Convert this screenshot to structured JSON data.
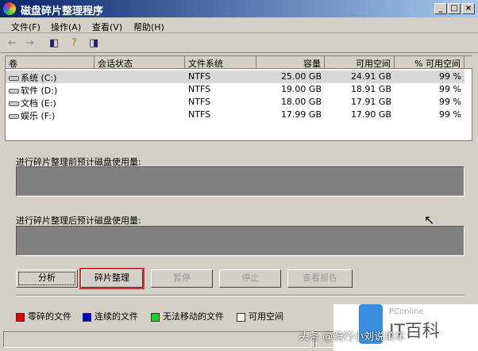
{
  "window": {
    "title": "磁盘碎片整理程序",
    "min": "_",
    "max": "□",
    "close": "×"
  },
  "menu": [
    "文件(F)",
    "操作(A)",
    "查看(V)",
    "帮助(H)"
  ],
  "columns": [
    "卷",
    "会话状态",
    "文件系统",
    "容量",
    "可用空间",
    "% 可用空间"
  ],
  "volumes": [
    {
      "name": "系统 (C:)",
      "status": "",
      "fs": "NTFS",
      "capacity": "25.00 GB",
      "free": "24.91 GB",
      "pct": "99 %"
    },
    {
      "name": "软件 (D:)",
      "status": "",
      "fs": "NTFS",
      "capacity": "19.00 GB",
      "free": "18.91 GB",
      "pct": "99 %"
    },
    {
      "name": "文档 (E:)",
      "status": "",
      "fs": "NTFS",
      "capacity": "18.00 GB",
      "free": "17.91 GB",
      "pct": "99 %"
    },
    {
      "name": "娱乐 (F:)",
      "status": "",
      "fs": "NTFS",
      "capacity": "17.99 GB",
      "free": "17.90 GB",
      "pct": "99 %"
    }
  ],
  "before_label": "进行碎片整理前预计磁盘使用量:",
  "after_label": "进行碎片整理后预计磁盘使用量:",
  "buttons": {
    "analyze": "分析",
    "defrag": "碎片整理",
    "pause": "暂停",
    "stop": "停止",
    "report": "查看报告"
  },
  "legend": [
    {
      "label": "零碎的文件",
      "color": "#e00000"
    },
    {
      "label": "连续的文件",
      "color": "#0000d0"
    },
    {
      "label": "无法移动的文件",
      "color": "#20d020"
    },
    {
      "label": "可用空间",
      "color": "#ffffff"
    }
  ],
  "watermark": {
    "brand": "PConline",
    "name": "IT百科",
    "credit": "头条 @骑行小刘说单车"
  }
}
